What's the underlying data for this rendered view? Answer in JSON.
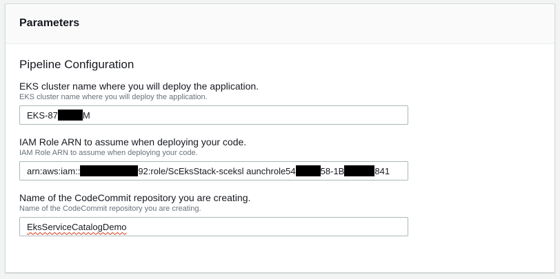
{
  "panel": {
    "title": "Parameters"
  },
  "section": {
    "title": "Pipeline Configuration"
  },
  "fields": [
    {
      "label": "EKS cluster name where you will deploy the application.",
      "description": "EKS cluster name where you will deploy the application.",
      "value_parts": [
        "EKS-87",
        "M"
      ]
    },
    {
      "label": "IAM Role ARN to assume when deploying your code.",
      "description": "IAM Role ARN to assume when deploying your code.",
      "value_parts": [
        "arn:aws:iam::",
        "92:role/ScEksStack-sceksl aunchrole54",
        "58-1B",
        "841"
      ]
    },
    {
      "label": "Name of the CodeCommit repository you are creating.",
      "description": "Name of the CodeCommit repository you are creating.",
      "value": "EksServiceCatalogDemo"
    }
  ]
}
